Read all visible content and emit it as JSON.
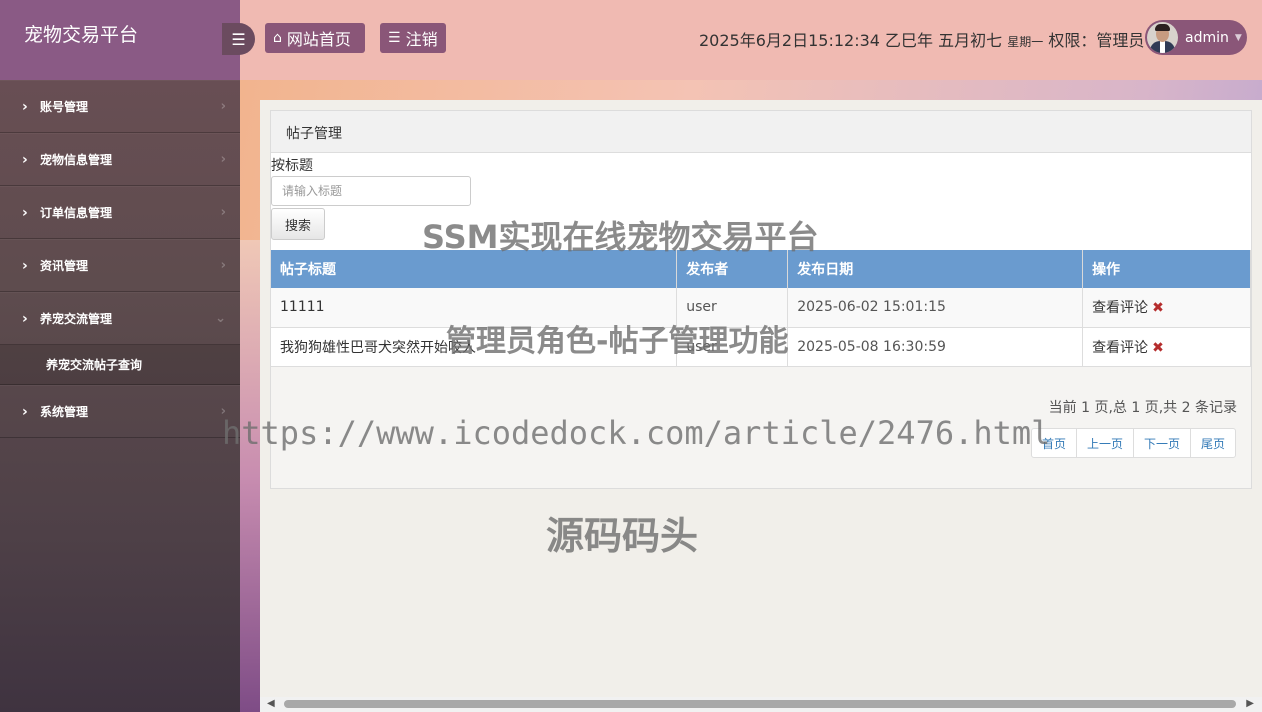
{
  "sidebar": {
    "brand": "宠物交易平台",
    "items": [
      {
        "label": "账号管理"
      },
      {
        "label": "宠物信息管理"
      },
      {
        "label": "订单信息管理"
      },
      {
        "label": "资讯管理"
      },
      {
        "label": "养宠交流管理"
      },
      {
        "label": "系统管理"
      }
    ],
    "submenu": {
      "label": "养宠交流帖子查询"
    }
  },
  "header": {
    "home_label": "网站首页",
    "logout_label": "注销",
    "datetime": "2025年6月2日15:12:34 乙巳年 五月初七",
    "weekday": "星期一",
    "permission": "权限：管理员",
    "username": "admin"
  },
  "panel": {
    "title": "帖子管理",
    "search_label": "按标题",
    "search_placeholder": "请输入标题",
    "search_button": "搜索",
    "columns": [
      "帖子标题",
      "发布者",
      "发布日期",
      "操作"
    ],
    "rows": [
      {
        "title": "11111",
        "author": "user",
        "date": "2025-06-02 15:01:15",
        "action": "查看评论"
      },
      {
        "title": "我狗狗雄性巴哥犬突然开始咬人",
        "author": "user",
        "date": "2025-05-08 16:30:59",
        "action": "查看评论"
      }
    ],
    "pager_info": "当前 1 页,总 1 页,共 2 条记录",
    "pager": {
      "first": "首页",
      "prev": "上一页",
      "next": "下一页",
      "last": "尾页"
    }
  },
  "watermarks": {
    "line1": "SSM实现在线宠物交易平台",
    "line2": "管理员角色-帖子管理功能",
    "line3": "https://www.icodedock.com/article/2476.html",
    "line4": "源码码头"
  },
  "colors": {
    "sidebar_brand": "#8a5a85",
    "header_bg": "#f0bab2",
    "header_button": "#8a5678",
    "table_header": "#6a9bcf",
    "delete_icon": "#b52d2d"
  },
  "icons": {
    "toggle": "hamburger-icon",
    "home": "home-icon",
    "logout": "list-icon",
    "delete": "close-icon"
  }
}
